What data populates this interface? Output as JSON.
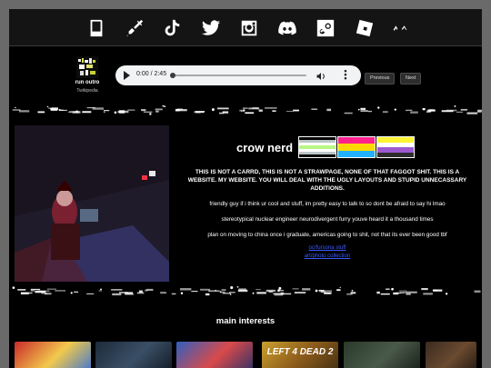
{
  "nav_icons": [
    {
      "name": "book-icon"
    },
    {
      "name": "paintbrush-icon"
    },
    {
      "name": "tiktok-icon"
    },
    {
      "name": "twitter-icon"
    },
    {
      "name": "instagram-icon"
    },
    {
      "name": "discord-icon"
    },
    {
      "name": "steam-icon"
    },
    {
      "name": "roblox-icon"
    },
    {
      "name": "cat-ears-icon"
    }
  ],
  "music": {
    "title": "run outro",
    "artist": "Twikipedia",
    "time": "0:00 / 2:45",
    "progress": 0,
    "prev_label": "Previous",
    "next_label": "Next"
  },
  "profile": {
    "name": "crow nerd",
    "flags": [
      {
        "name": "agender-flag",
        "colors": [
          "#000000",
          "#bcc4c7",
          "#ffffff",
          "#b7f684",
          "#ffffff",
          "#bcc4c7",
          "#000000"
        ]
      },
      {
        "name": "pansexual-flag",
        "colors": [
          "#ff218c",
          "#ffd800",
          "#21b1ff"
        ]
      },
      {
        "name": "nonbinary-flag",
        "colors": [
          "#fcf434",
          "#ffffff",
          "#9c59d1",
          "#2c2c2c"
        ]
      }
    ],
    "notice": "THIS IS NOT A CARRD, THIS IS NOT A STRAWPAGE, NONE OF THAT FAGGOT SHIT. THIS IS A WEBSITE. MY WEBSITE. YOU WILL DEAL WITH THE UGLY LAYOUTS AND STUPID UNNECASSARY ADDITIONS.",
    "line1": "friendly guy if i think ur cool and stuff, im pretty easy to talk to so dont be afraid to say hi lmao",
    "line2": "stereotypical nuclear engineer neurodivergent furry youve heard it a thousand times",
    "line3": "plan on moving to china once i graduate, americas going to shit, not that its ever been good tbf",
    "link1": "oc/fursona stuff",
    "link2": "art/photo collection"
  },
  "interests": {
    "heading": "main interests",
    "items": [
      {
        "label": "",
        "colors": [
          "#c92a2a",
          "#f2c94c",
          "#2d6cdf"
        ]
      },
      {
        "label": "",
        "colors": [
          "#1d2a3a",
          "#3a4f66",
          "#0e141c"
        ]
      },
      {
        "label": "",
        "colors": [
          "#2f5fbf",
          "#d94a4a",
          "#1a2f6b"
        ]
      },
      {
        "label": "LEFT 4 DEAD 2",
        "colors": [
          "#caa02e",
          "#8a5a1a",
          "#3a2a14"
        ]
      },
      {
        "label": "",
        "colors": [
          "#2a3a2a",
          "#4a5a4a",
          "#121812"
        ]
      },
      {
        "label": "",
        "colors": [
          "#3a2a20",
          "#6a4a30",
          "#1a120c"
        ]
      }
    ]
  }
}
